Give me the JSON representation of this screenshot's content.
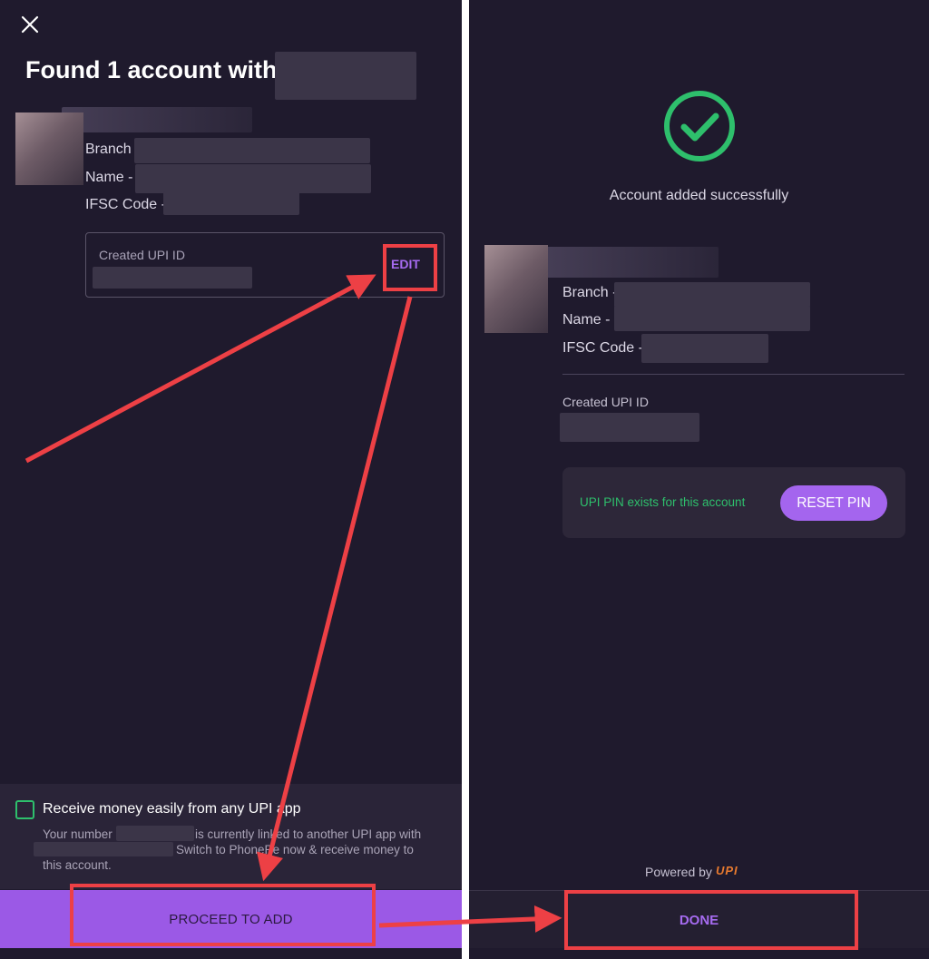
{
  "left": {
    "title": "Found 1 account with",
    "branch_label": "Branch",
    "name_label": "Name -",
    "ifsc_label": "IFSC Code -",
    "upi_card": {
      "label": "Created UPI ID",
      "edit_label": "EDIT"
    },
    "receive": {
      "title": "Receive money easily from any UPI app",
      "line1_a": "Your number",
      "line1_b": "is currently linked to another UPI app with",
      "line2_b": "Switch to PhonePe now & receive money to",
      "line3": "this account."
    },
    "proceed_label": "PROCEED TO ADD"
  },
  "right": {
    "success_text": "Account added successfully",
    "branch_label": "Branch -",
    "name_label": "Name -",
    "ifsc_label": "IFSC Code -",
    "upi_label": "Created UPI ID",
    "pin_status": "UPI PIN exists for this account",
    "reset_pin_label": "RESET PIN",
    "powered_by": "Powered by",
    "upi_logo": "UPI",
    "done_label": "DONE"
  },
  "colors": {
    "background": "#1f1a2d",
    "accent_purple": "#9b59e6",
    "success_green": "#2ebf6c",
    "annotation_red": "#ed4045"
  },
  "icons": {
    "close": "close-icon",
    "success": "check-circle-icon"
  }
}
